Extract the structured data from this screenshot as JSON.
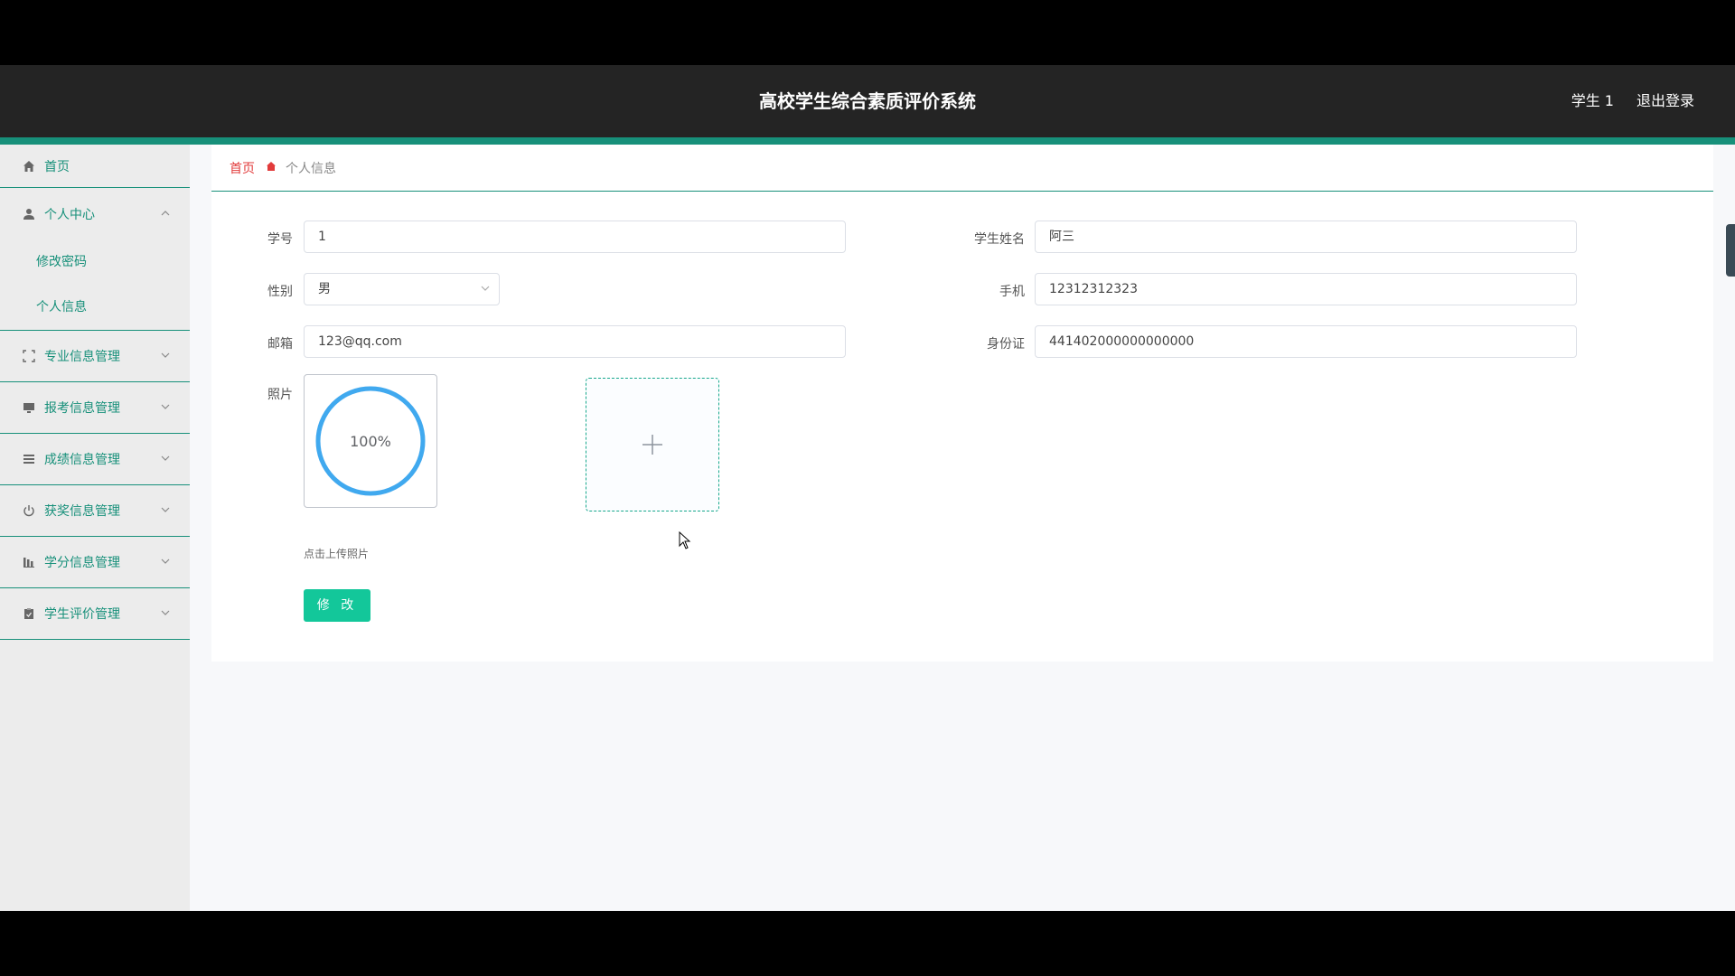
{
  "header": {
    "title": "高校学生综合素质评价系统",
    "user": "学生 1",
    "logout": "退出登录"
  },
  "sidebar": {
    "items": [
      {
        "label": "首页",
        "icon": "home-icon"
      },
      {
        "label": "个人中心",
        "icon": "user-icon",
        "expanded": true,
        "children": [
          {
            "label": "修改密码"
          },
          {
            "label": "个人信息"
          }
        ]
      },
      {
        "label": "专业信息管理",
        "icon": "fullscreen-icon"
      },
      {
        "label": "报考信息管理",
        "icon": "monitor-icon"
      },
      {
        "label": "成绩信息管理",
        "icon": "list-icon"
      },
      {
        "label": "获奖信息管理",
        "icon": "power-icon"
      },
      {
        "label": "学分信息管理",
        "icon": "chart-icon"
      },
      {
        "label": "学生评价管理",
        "icon": "clipboard-icon"
      }
    ]
  },
  "breadcrumb": {
    "home": "首页",
    "current": "个人信息"
  },
  "form": {
    "student_id_label": "学号",
    "student_id": "1",
    "name_label": "学生姓名",
    "name": "阿三",
    "gender_label": "性别",
    "gender": "男",
    "phone_label": "手机",
    "phone": "12312312323",
    "email_label": "邮箱",
    "email": "123@qq.com",
    "idcard_label": "身份证",
    "idcard": "441402000000000000",
    "photo_label": "照片",
    "upload_progress": "100%",
    "upload_hint": "点击上传照片",
    "submit": "修 改"
  },
  "colors": {
    "accent": "#17907a",
    "button": "#13c79a",
    "progress": "#40a9ef",
    "breadcrumb_home": "#e23b3b"
  }
}
